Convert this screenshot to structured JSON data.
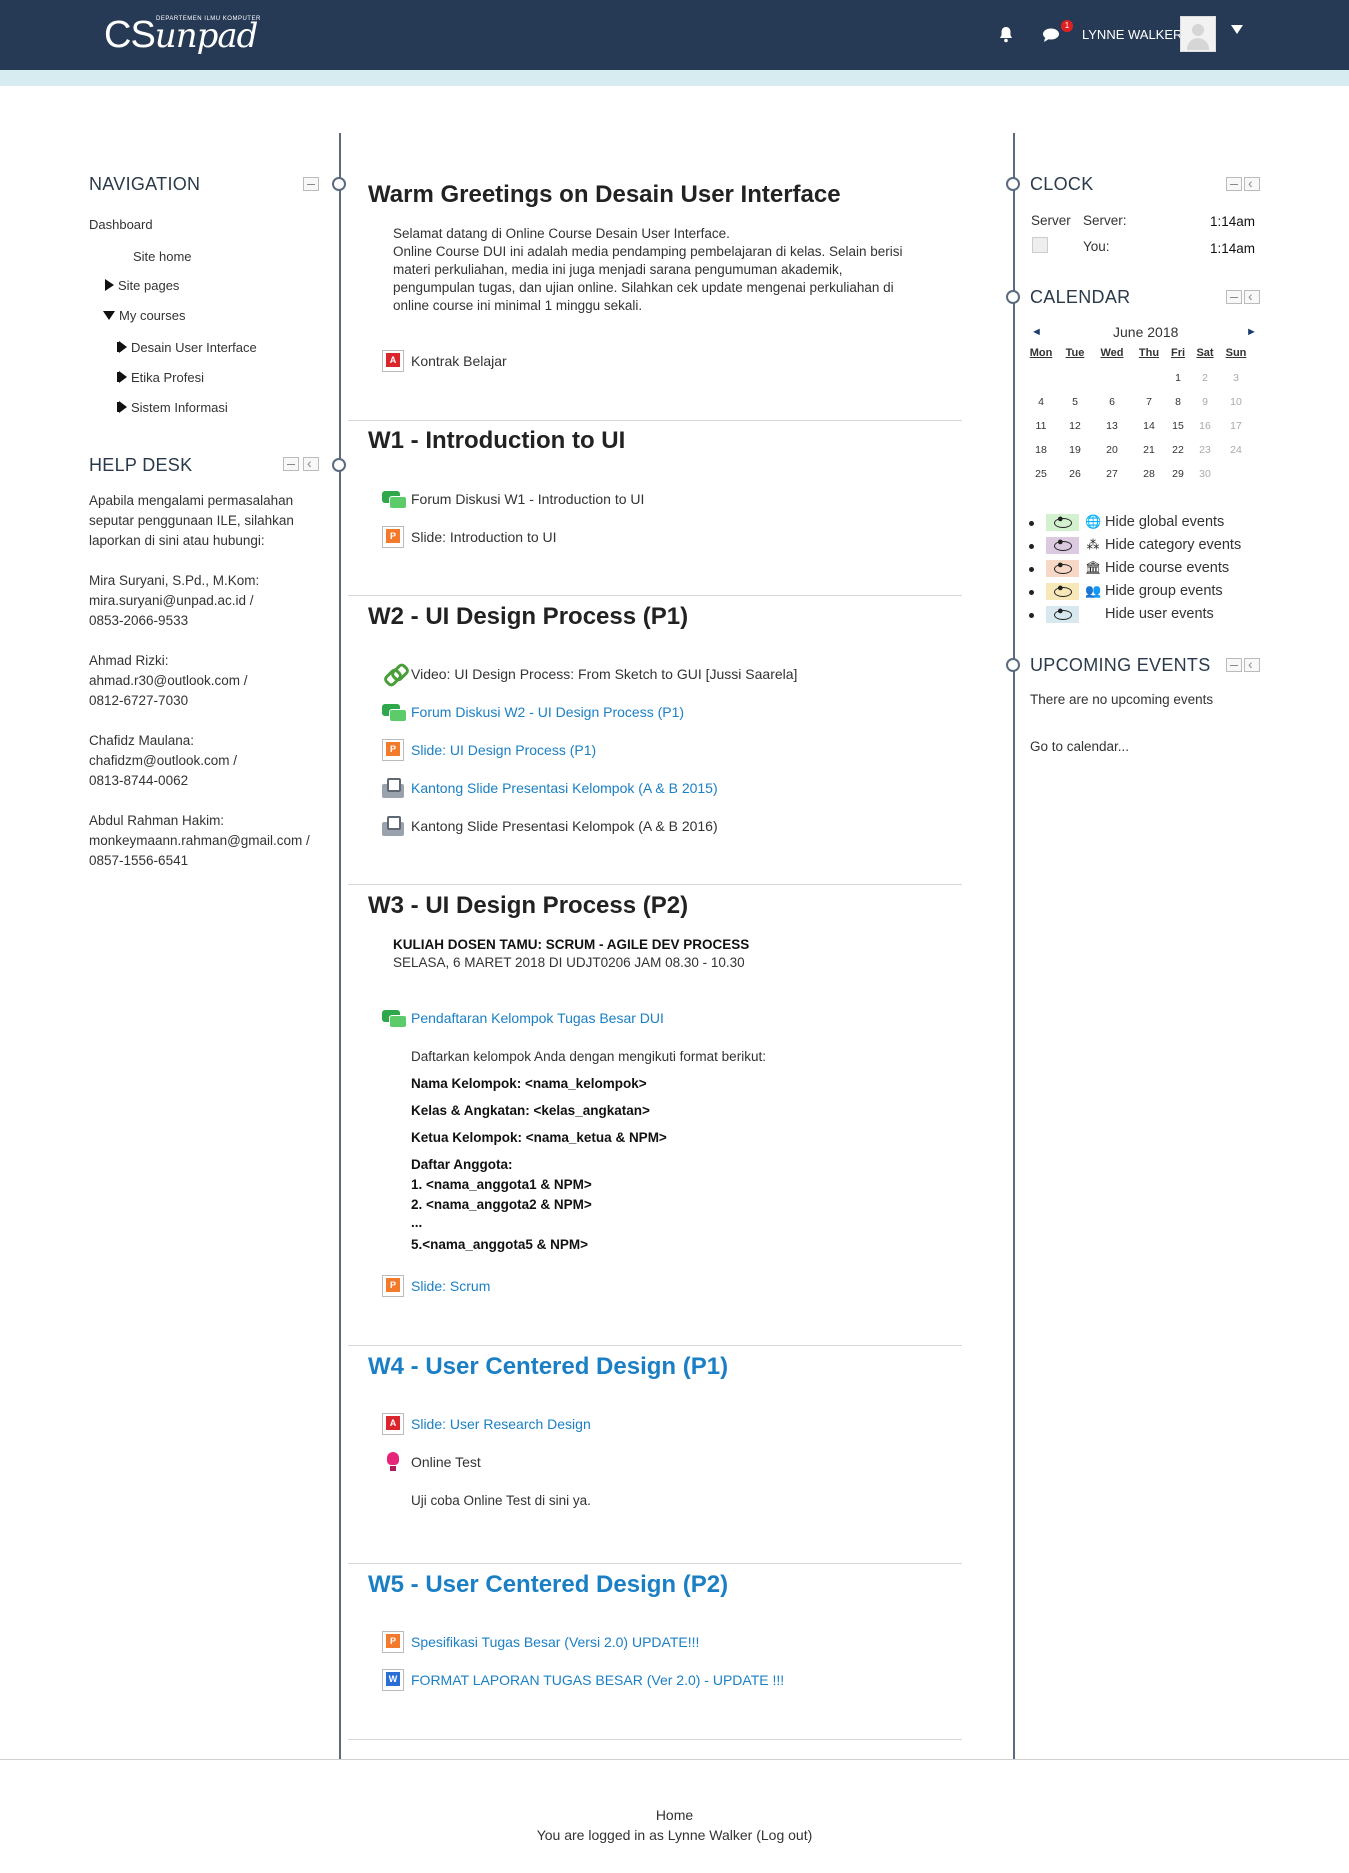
{
  "header": {
    "logo_main": "CS",
    "logo_sub": "unpad",
    "logo_tag": "DEPARTEMEN ILMU KOMPUTER",
    "notifications_icon": "bell-icon",
    "messages_icon": "chat-icon",
    "messages_badge": "1",
    "user_name": "LYNNE WALKER",
    "bar_color": "#273a55",
    "accent_color": "#d7ecf1"
  },
  "navigation": {
    "title": "NAVIGATION",
    "items": [
      {
        "label": "Dashboard"
      },
      {
        "label": "Site home"
      },
      {
        "label": "Site pages"
      },
      {
        "label": "My courses"
      },
      {
        "label": "Desain User Interface"
      },
      {
        "label": "Etika Profesi"
      },
      {
        "label": "Sistem Informasi"
      }
    ]
  },
  "helpdesk": {
    "title": "HELP DESK",
    "lines": [
      "Apabila mengalami permasalahan",
      "seputar penggunaan ILE, silahkan",
      "laporkan di sini atau hubungi:",
      "Mira Suryani, S.Pd., M.Kom:",
      "mira.suryani@unpad.ac.id /",
      "0853-2066-9533",
      "Ahmad Rizki:",
      "ahmad.r30@outlook.com /",
      "0812-6727-7030",
      "Chafidz Maulana:",
      "chafidzm@outlook.com /",
      "0813-8744-0062",
      "Abdul Rahman Hakim:",
      "monkeymaann.rahman@gmail.com /",
      "0857-1556-6541"
    ]
  },
  "main": {
    "intro": {
      "title": "Warm Greetings on Desain User Interface",
      "lines": [
        "Selamat datang di Online Course Desain User Interface.",
        "Online Course DUI ini adalah media pendamping pembelajaran di kelas. Selain berisi",
        "materi perkuliahan, media ini juga menjadi sarana pengumuman akademik,",
        "pengumpulan tugas, dan ujian online. Silahkan cek update mengenai perkuliahan di",
        "online course ini minimal 1 minggu sekali."
      ],
      "resource": "Kontrak Belajar"
    },
    "w1": {
      "title": "W1 - Introduction to UI",
      "resources": [
        "Forum Diskusi W1 - Introduction to UI",
        "Slide: Introduction to UI"
      ]
    },
    "w2": {
      "title": "W2 - UI Design Process (P1)",
      "resources": [
        "Video: UI Design Process: From Sketch to GUI [Jussi Saarela]",
        "Forum Diskusi W2 - UI Design Process (P1)",
        "Slide: UI Design Process (P1)",
        "Kantong Slide Presentasi Kelompok (A & B 2015)",
        "Kantong Slide Presentasi Kelompok (A & B 2016)"
      ]
    },
    "w3": {
      "title": "W3 - UI Design Process (P2)",
      "guest_heading": "KULIAH DOSEN TAMU: SCRUM - AGILE DEV PROCESS",
      "guest_detail": "SELASA, 6 MARET 2018 DI UDJT0206 JAM 08.30 - 10.30",
      "forum": "Pendaftaran Kelompok Tugas Besar DUI",
      "forum_intro": "Daftarkan kelompok Anda dengan mengikuti format berikut:",
      "format_lines": [
        "Nama Kelompok: <nama_kelompok>",
        "Kelas & Angkatan: <kelas_angkatan>",
        "Ketua Kelompok: <nama_ketua & NPM>",
        "Daftar Anggota:",
        "1. <nama_anggota1 & NPM>",
        "2. <nama_anggota2 & NPM>",
        "...",
        "5.<nama_anggota5 & NPM>"
      ],
      "slide": "Slide: Scrum"
    },
    "w4": {
      "title": "W4 - User Centered Design (P1)",
      "slide": "Slide: User Research Design",
      "quiz": "Online Test",
      "quiz_desc": "Uji coba Online Test di sini ya."
    },
    "w5": {
      "title": "W5 - User Centered Design (P2)",
      "resources": [
        "Spesifikasi Tugas Besar (Versi 2.0) UPDATE!!!",
        "FORMAT LAPORAN TUGAS BESAR (Ver 2.0) - UPDATE !!!"
      ]
    }
  },
  "clock": {
    "title": "CLOCK",
    "server_label": "Server",
    "server_label2": "Server:",
    "server_time": "1:14am",
    "you_label": "You:",
    "you_time": "1:14am"
  },
  "calendar": {
    "title": "CALENDAR",
    "month": "June 2018",
    "prev": "◄",
    "next": "►",
    "dow": [
      "Mon",
      "Tue",
      "Wed",
      "Thu",
      "Fri",
      "Sat",
      "Sun"
    ],
    "weeks": [
      [
        "",
        "",
        "",
        "",
        "1",
        "2",
        "3"
      ],
      [
        "4",
        "5",
        "6",
        "7",
        "8",
        "9",
        "10"
      ],
      [
        "11",
        "12",
        "13",
        "14",
        "15",
        "16",
        "17"
      ],
      [
        "18",
        "19",
        "20",
        "21",
        "22",
        "23",
        "24"
      ],
      [
        "25",
        "26",
        "27",
        "28",
        "29",
        "30",
        ""
      ]
    ],
    "events": [
      {
        "label": "Hide global events",
        "color": "#d3f0cf",
        "glyph": "🌐",
        "icon": "globe-icon"
      },
      {
        "label": "Hide category events",
        "color": "#dccbe0",
        "glyph": "⁂",
        "icon": "cubes-icon"
      },
      {
        "label": "Hide course events",
        "color": "#f7d7c6",
        "glyph": "🏛",
        "icon": "institution-icon"
      },
      {
        "label": "Hide group events",
        "color": "#f8e8b8",
        "glyph": "👥",
        "icon": "group-icon"
      },
      {
        "label": "Hide user events",
        "color": "#d7e8ee",
        "glyph": "",
        "icon": "user-icon"
      }
    ]
  },
  "upcoming": {
    "title": "UPCOMING EVENTS",
    "empty": "There are no upcoming events",
    "link": "Go to calendar..."
  },
  "footer": {
    "home": "Home",
    "logged_prefix": "You are logged in as",
    "user": "Lynne Walker",
    "logout": "(Log out)"
  }
}
